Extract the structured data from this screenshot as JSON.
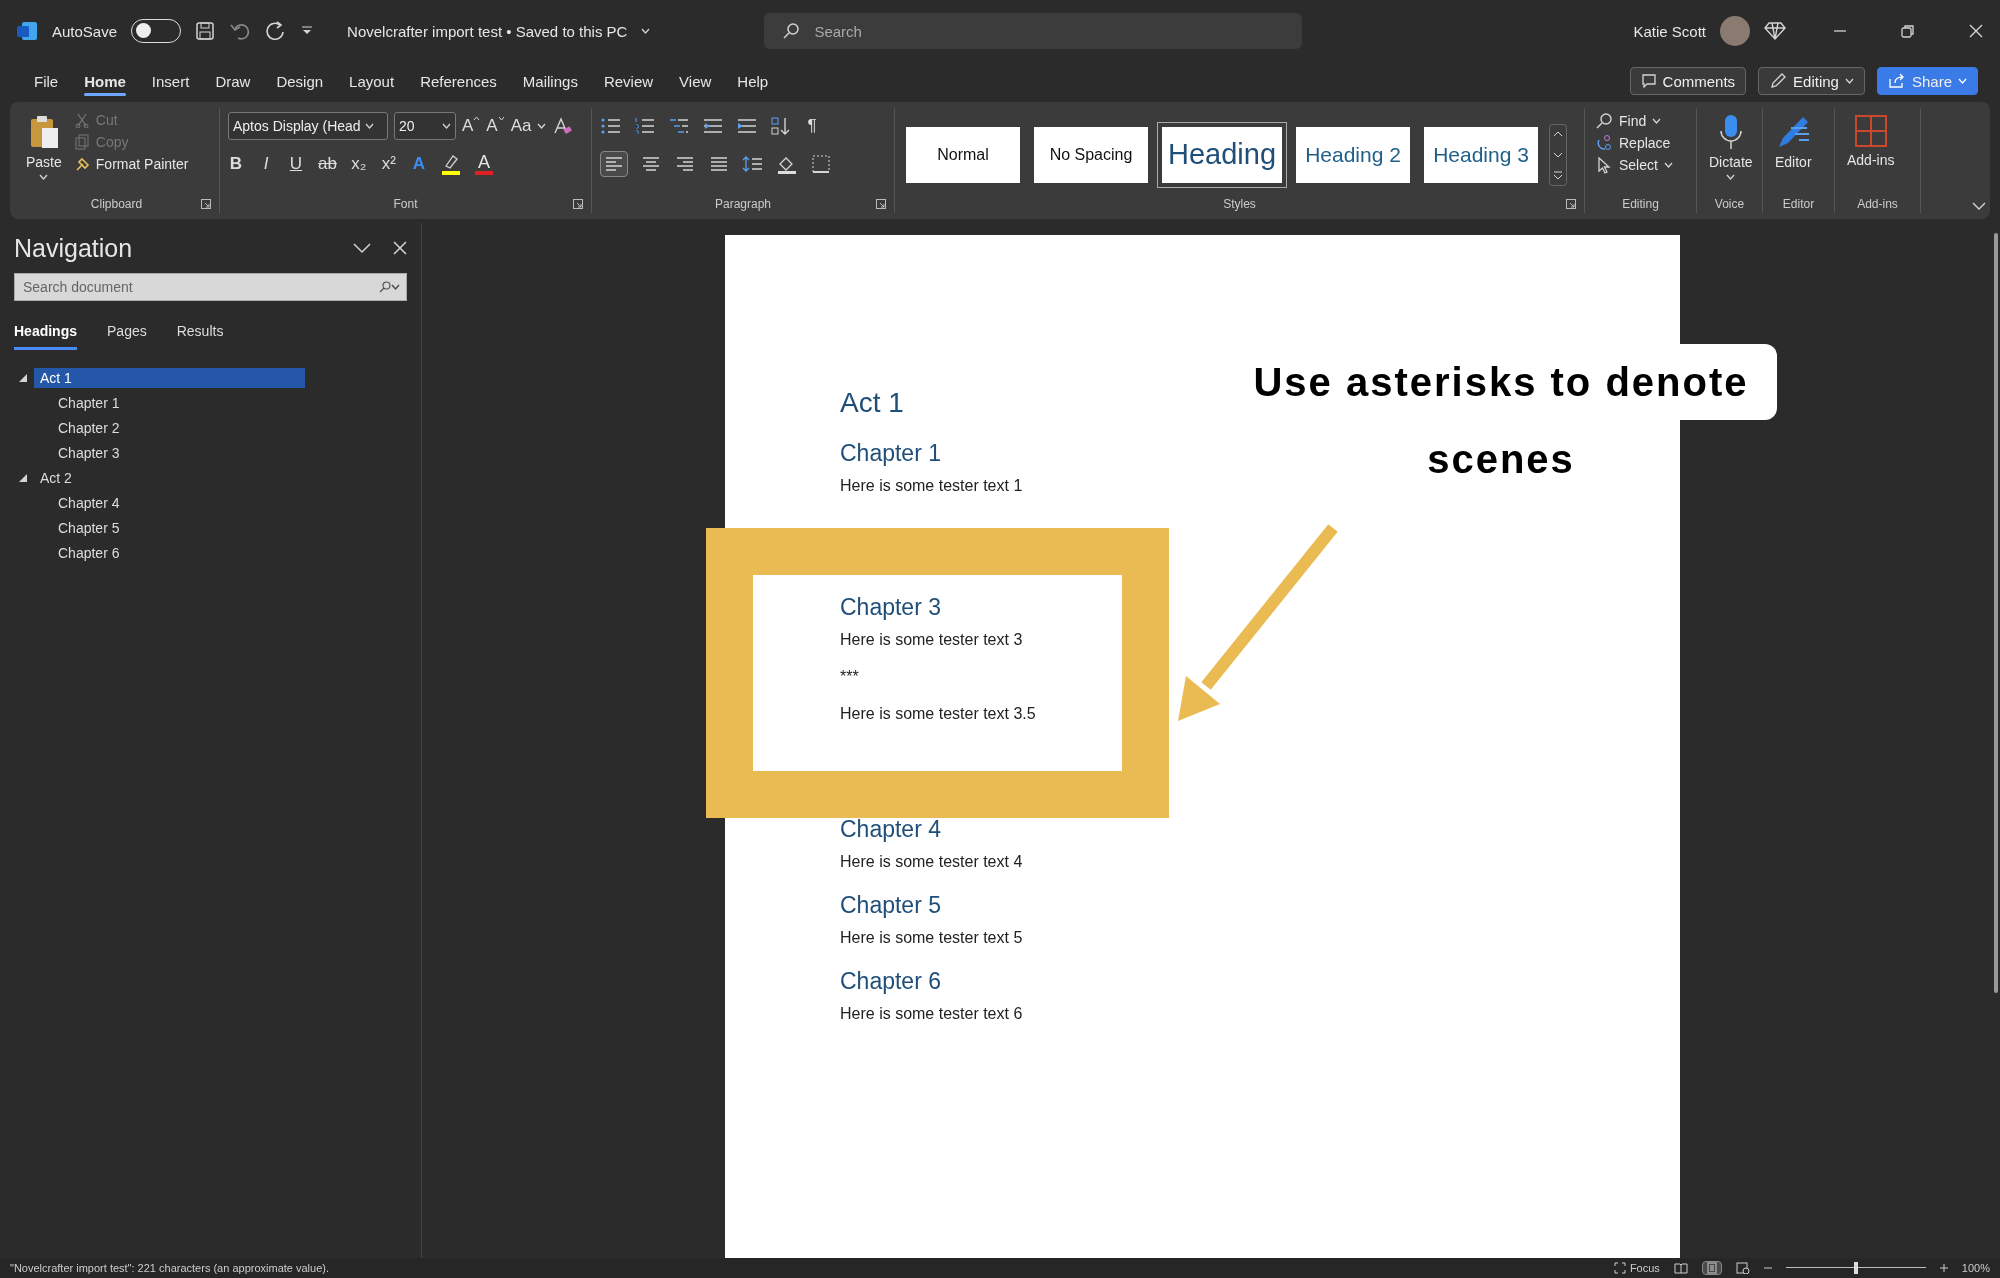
{
  "title_bar": {
    "autosave_label": "AutoSave",
    "autosave_on": false,
    "document_title": "Novelcrafter import test • Saved to this PC",
    "search_placeholder": "Search",
    "user_name": "Katie Scott"
  },
  "menu_tabs": [
    {
      "label": "File",
      "selected": false
    },
    {
      "label": "Home",
      "selected": true
    },
    {
      "label": "Insert",
      "selected": false
    },
    {
      "label": "Draw",
      "selected": false
    },
    {
      "label": "Design",
      "selected": false
    },
    {
      "label": "Layout",
      "selected": false
    },
    {
      "label": "References",
      "selected": false
    },
    {
      "label": "Mailings",
      "selected": false
    },
    {
      "label": "Review",
      "selected": false
    },
    {
      "label": "View",
      "selected": false
    },
    {
      "label": "Help",
      "selected": false
    }
  ],
  "header_buttons": {
    "comments": "Comments",
    "editing": "Editing",
    "share": "Share"
  },
  "ribbon": {
    "clipboard": {
      "label": "Clipboard",
      "paste": "Paste",
      "items": [
        {
          "label": "Cut",
          "disabled": true
        },
        {
          "label": "Copy",
          "disabled": true
        },
        {
          "label": "Format Painter",
          "disabled": false
        }
      ]
    },
    "font": {
      "label": "Font",
      "font_name": "Aptos Display (Head",
      "font_size": "20",
      "grow": "A",
      "shrink": "A",
      "case": "Aa",
      "format_buttons": [
        "B",
        "I",
        "U",
        "ab",
        "x₂",
        "x²"
      ],
      "effects": "A",
      "font_color": "A"
    },
    "paragraph": {
      "label": "Paragraph",
      "pilcrow": "¶"
    },
    "styles": {
      "label": "Styles",
      "items": [
        {
          "label": "Normal",
          "kind": "plain",
          "selected": false
        },
        {
          "label": "No Spacing",
          "kind": "plain",
          "selected": false
        },
        {
          "label": "Heading",
          "kind": "heading",
          "selected": true
        },
        {
          "label": "Heading 2",
          "kind": "subheading",
          "selected": false
        },
        {
          "label": "Heading 3",
          "kind": "subheading",
          "selected": false
        }
      ]
    },
    "editing": {
      "label": "Editing",
      "items": [
        "Find",
        "Replace",
        "Select"
      ]
    },
    "voice": {
      "label": "Voice",
      "button": "Dictate"
    },
    "editor": {
      "label": "Editor",
      "button": "Editor"
    },
    "addins": {
      "label": "Add-ins",
      "button": "Add-ins"
    }
  },
  "navigation": {
    "title": "Navigation",
    "search_placeholder": "Search document",
    "tabs": [
      {
        "label": "Headings",
        "selected": true
      },
      {
        "label": "Pages",
        "selected": false
      },
      {
        "label": "Results",
        "selected": false
      }
    ],
    "headings": [
      {
        "label": "Act 1",
        "selected": true,
        "expanded": true,
        "children": [
          {
            "label": "Chapter 1",
            "selected": false
          },
          {
            "label": "Chapter 2",
            "selected": false
          },
          {
            "label": "Chapter 3",
            "selected": false
          }
        ]
      },
      {
        "label": "Act 2",
        "selected": false,
        "expanded": true,
        "children": [
          {
            "label": "Chapter 4",
            "selected": false
          },
          {
            "label": "Chapter 5",
            "selected": false
          },
          {
            "label": "Chapter 6",
            "selected": false
          }
        ]
      }
    ]
  },
  "document": {
    "sections": [
      [
        {
          "kind": "h1",
          "text": "Act 1"
        },
        {
          "kind": "h2",
          "text": "Chapter 1"
        },
        {
          "kind": "body",
          "text": "Here is some tester text 1"
        }
      ],
      [
        {
          "kind": "h2",
          "text": "Chapter 3"
        },
        {
          "kind": "body",
          "text": "Here is some tester text 3"
        },
        {
          "kind": "body",
          "text": "***"
        },
        {
          "kind": "body",
          "text": "Here is some tester text 3.5"
        }
      ],
      [
        {
          "kind": "h2",
          "text": "Chapter 4"
        },
        {
          "kind": "body",
          "text": "Here is some tester text 4"
        },
        {
          "kind": "h2",
          "text": "Chapter 5"
        },
        {
          "kind": "body",
          "text": "Here is some tester text 5"
        },
        {
          "kind": "h2",
          "text": "Chapter 6"
        },
        {
          "kind": "body",
          "text": "Here is some tester text 6"
        }
      ]
    ]
  },
  "annotation": {
    "callout": "Use asterisks to denote scenes"
  },
  "status_bar": {
    "message": "\"Novelcrafter import test\": 221 characters (an approximate value).",
    "focus": "Focus",
    "zoom": {
      "level": 0.5
    },
    "zoom_label": "100%"
  }
}
